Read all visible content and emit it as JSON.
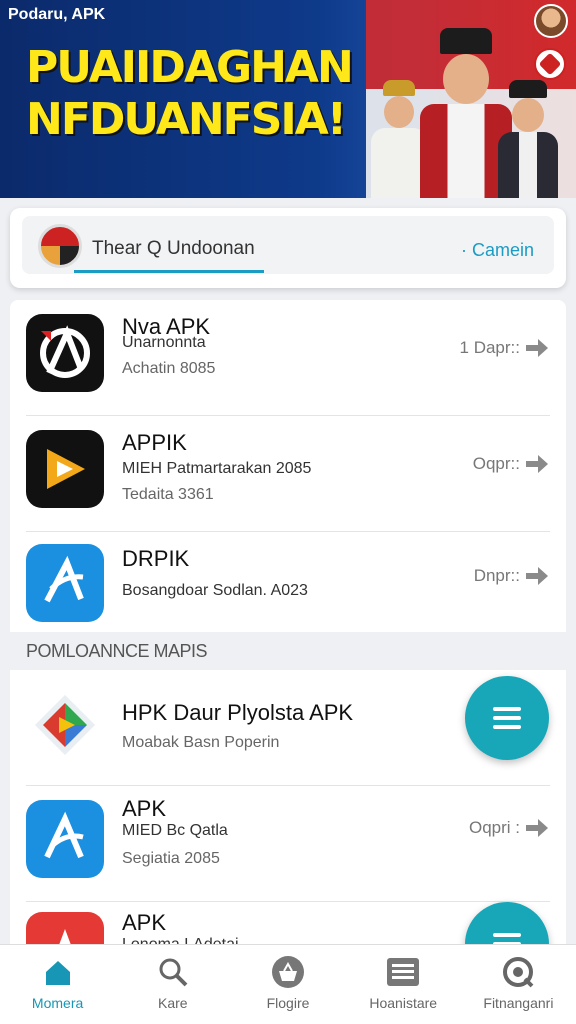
{
  "banner": {
    "brand": "Podaru, APK",
    "headline_line1": "PUAIIDAGHAN",
    "headline_line2": "NFDUANFSIA!"
  },
  "search": {
    "placeholder_text": "Thear Q Undoonan",
    "cta_label": "· Camein"
  },
  "apps_top": [
    {
      "title": "Nva APK",
      "subtitle": "Unarnonnta",
      "meta": "Achatin 8085",
      "action": "1 Dapr::",
      "icon": "apk-a-logo-icon"
    },
    {
      "title": "APPIK",
      "subtitle": "MIEH Patmartarakan 2085",
      "meta": "Tedaita 3361",
      "action": "Oqpr::",
      "icon": "play-logo-icon"
    },
    {
      "title": "DRPIK",
      "subtitle": "Bosangdoar Sodlan. A023",
      "meta": "",
      "action": "Dnpr::",
      "icon": "apk-a-logo-icon"
    }
  ],
  "section_title": "POMLOANNCE MAPIS",
  "apps_bottom": [
    {
      "title": "HPK Daur Plyolsta APK",
      "subtitle": "Moabak Basn Poperin",
      "meta": "",
      "action": "",
      "icon": "play-store-logo-icon"
    },
    {
      "title": "APK",
      "subtitle": "MIED Bc Qatla",
      "meta": "Segiatia 2085",
      "action": "Oqpri :",
      "icon": "apk-a-logo-icon"
    },
    {
      "title": "APK",
      "subtitle": "Lonoma LAdetai",
      "meta": "",
      "action": "",
      "icon": "star-logo-icon"
    }
  ],
  "bottom_nav": [
    {
      "label": "Momera",
      "icon": "home-icon",
      "active": true
    },
    {
      "label": "Kare",
      "icon": "search-icon",
      "active": false
    },
    {
      "label": "Flogire",
      "icon": "basket-icon",
      "active": false
    },
    {
      "label": "Hoanistare",
      "icon": "list-icon",
      "active": false
    },
    {
      "label": "Fitnanganri",
      "icon": "update-icon",
      "active": false
    }
  ],
  "colors": {
    "accent": "#1796b5",
    "fab": "#17a7b8",
    "headline": "#ffe81a"
  }
}
